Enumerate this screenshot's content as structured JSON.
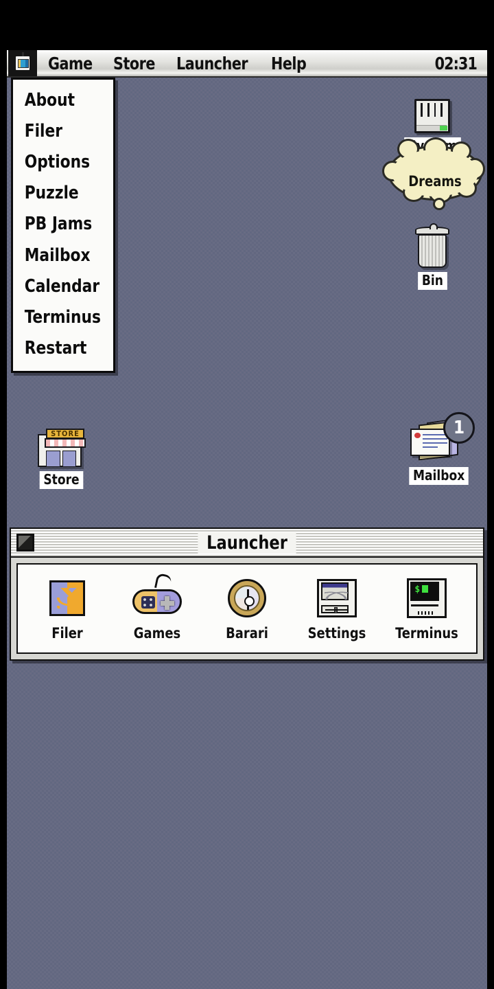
{
  "menubar": {
    "apple_icon": "tv-icon",
    "items": [
      {
        "label": "Game"
      },
      {
        "label": "Store"
      },
      {
        "label": "Launcher"
      },
      {
        "label": "Help"
      }
    ],
    "clock": "02:31"
  },
  "dropdown": {
    "open_from": "Game",
    "items": [
      {
        "label": "About"
      },
      {
        "label": "Filer"
      },
      {
        "label": "Options"
      },
      {
        "label": "Puzzle"
      },
      {
        "label": "PB Jams"
      },
      {
        "label": "Mailbox"
      },
      {
        "label": "Calendar"
      },
      {
        "label": "Terminus"
      },
      {
        "label": "Restart"
      }
    ]
  },
  "desktop": {
    "background_color": "#626780",
    "icons": [
      {
        "name": "system-drive",
        "label": "System",
        "icon": "hard-drive-icon"
      },
      {
        "name": "trash",
        "label": "Bin",
        "icon": "trash-can-icon"
      },
      {
        "name": "store",
        "label": "Store",
        "icon": "storefront-icon",
        "sign_text": "STORE"
      },
      {
        "name": "mailbox",
        "label": "Mailbox",
        "icon": "letters-icon",
        "badge": "1"
      }
    ],
    "thought_bubble": {
      "text": "Dreams",
      "color": "#f4efc4"
    }
  },
  "launcher_window": {
    "title": "Launcher",
    "close_box": "close-box",
    "items": [
      {
        "label": "Filer",
        "icon": "filer-icon"
      },
      {
        "label": "Games",
        "icon": "gamepad-icon"
      },
      {
        "label": "Barari",
        "icon": "compass-icon"
      },
      {
        "label": "Settings",
        "icon": "control-panel-icon"
      },
      {
        "label": "Terminus",
        "icon": "terminal-computer-icon"
      }
    ]
  }
}
